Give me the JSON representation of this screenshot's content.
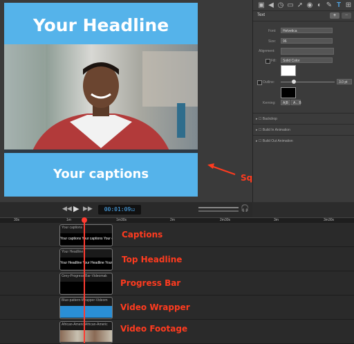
{
  "canvas": {
    "headline": "Your Headline",
    "captions": "Your captions"
  },
  "inspector": {
    "tab_title": "Text",
    "font_label": "Font:",
    "font_value": "Helvetica",
    "size_label": "Size:",
    "size_value": "96",
    "alignment_label": "Alignment:",
    "fill_label": "Fill:",
    "fill_value": "Solid Color",
    "outline_label": "Outline:",
    "outline_value": "3.0 pt",
    "kerning_label": "Kerning:",
    "kerning_buttons": [
      "A|B",
      "A←B"
    ],
    "sections": [
      "Backdrop",
      "Build In Animation",
      "Build Out Animation"
    ],
    "icons": [
      "video-icon",
      "audio-icon",
      "speed-icon",
      "screen-icon",
      "cursor-icon",
      "shape-icon",
      "color-icon",
      "pen-icon",
      "text-icon",
      "grid-icon"
    ]
  },
  "transport": {
    "timecode": "00:01:09",
    "frames": "12"
  },
  "ruler": {
    "ticks": [
      "30s",
      "1m",
      "1m30s",
      "2m",
      "2m30s",
      "3m",
      "3m30s"
    ]
  },
  "tracks": [
    {
      "clip_name": "Your captions",
      "strip_text": "Your captions  Your captions  Your cap",
      "annotation": "Captions"
    },
    {
      "clip_name": "Your Headline",
      "strip_text": "Your Headline  Your Headline  Your He",
      "annotation": "Top Headline"
    },
    {
      "clip_name": "Grey-Progress-Bar-Videomak",
      "strip_text": "",
      "annotation": "Progress Bar"
    },
    {
      "clip_name": "Blue-pattern-Wrapper-Videom",
      "strip_text": "",
      "annotation": "Video Wrapper"
    },
    {
      "clip_name": "African-Americ  African-Americ",
      "strip_text": "",
      "annotation": "Video Footage"
    }
  ],
  "callout": "Square Canvas",
  "colors": {
    "accent_blue": "#55b3ea",
    "annotation_red": "#ff3b1f",
    "playhead": "#ff3b30"
  }
}
